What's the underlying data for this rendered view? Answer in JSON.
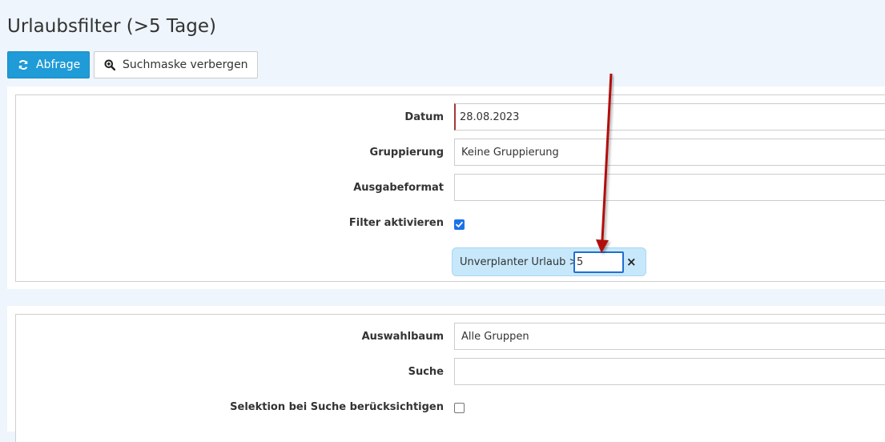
{
  "page": {
    "title": "Urlaubsfilter (>5 Tage)"
  },
  "toolbar": {
    "query_label": "Abfrage",
    "query_icon": "refresh-icon",
    "toggle_label": "Suchmaske verbergen",
    "toggle_icon": "zoom-in-icon"
  },
  "form1": {
    "datum_label": "Datum",
    "datum_value": "28.08.2023",
    "gruppierung_label": "Gruppierung",
    "gruppierung_value": "Keine Gruppierung",
    "ausgabeformat_label": "Ausgabeformat",
    "ausgabeformat_value": "",
    "filter_label": "Filter aktivieren",
    "filter_checked": true,
    "filter_pill": {
      "label": "Unverplanter Urlaub >",
      "value": "5",
      "close_symbol": "×"
    }
  },
  "form2": {
    "auswahlbaum_label": "Auswahlbaum",
    "auswahlbaum_value": "Alle Gruppen",
    "suche_label": "Suche",
    "suche_value": "",
    "selektion_label": "Selektion bei Suche berücksichtigen",
    "selektion_checked": false
  },
  "colors": {
    "primary": "#1f9bd7",
    "annotation_arrow": "#b20f10",
    "pill_bg": "#c7e8fb",
    "focus_border": "#1f6fd1"
  }
}
